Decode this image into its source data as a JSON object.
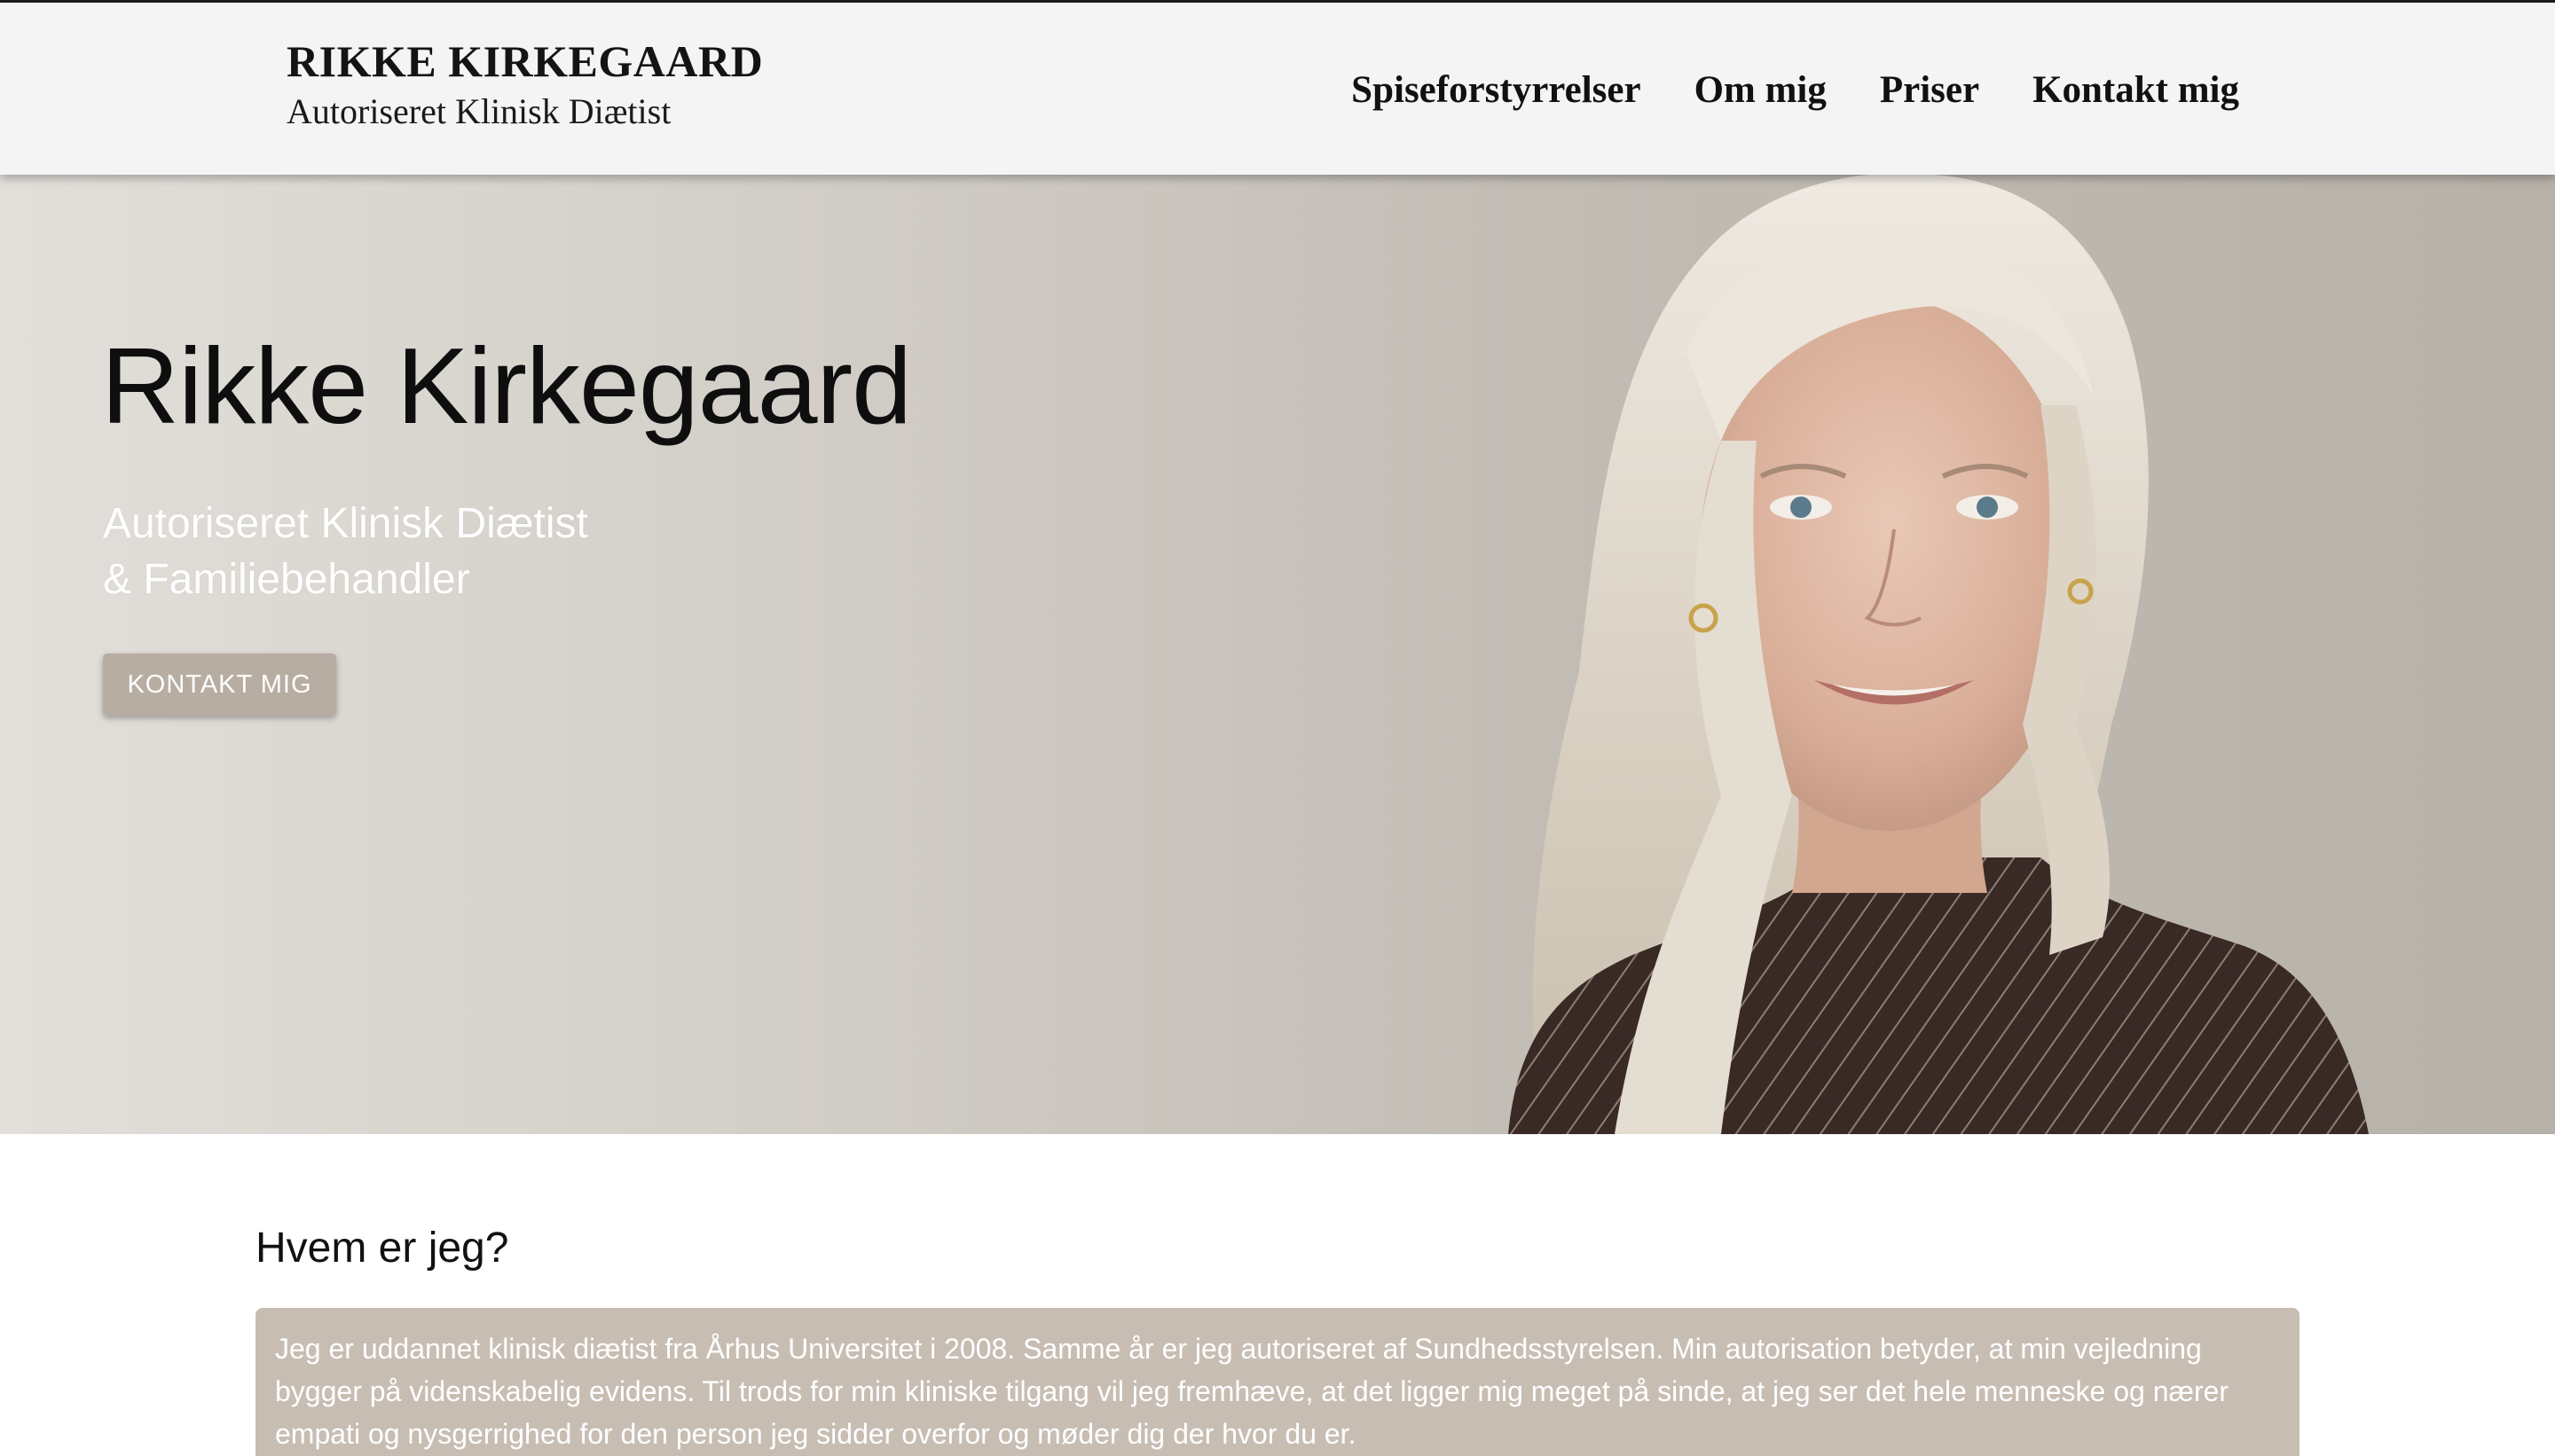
{
  "header": {
    "brand_name": "RIKKE KIRKEGAARD",
    "brand_subtitle": "Autoriseret Klinisk Diætist",
    "nav": [
      {
        "label": "Spiseforstyrrelser"
      },
      {
        "label": "Om mig"
      },
      {
        "label": "Priser"
      },
      {
        "label": "Kontakt mig"
      }
    ]
  },
  "hero": {
    "title": "Rikke Kirkegaard",
    "subtitle_line1": "Autoriseret Klinisk Diætist",
    "subtitle_line2": "& Familiebehandler",
    "cta_label": "KONTAKT MIG"
  },
  "about": {
    "heading": "Hvem er jeg?",
    "body": "Jeg er uddannet klinisk diætist fra Århus Universitet i 2008. Samme år er jeg autoriseret af Sundhedsstyrelsen. Min autorisation betyder, at min vejledning bygger på videnskabelig evidens. Til trods for min kliniske tilgang vil jeg fremhæve, at det ligger mig meget på sinde, at jeg ser det hele menneske og nærer empati og nysgerrighed for den person jeg sidder overfor og møder dig der hvor du er."
  },
  "colors": {
    "header_bg": "#f4f4f4",
    "accent": "#b8ada3",
    "about_box": "#c7bdb3"
  }
}
